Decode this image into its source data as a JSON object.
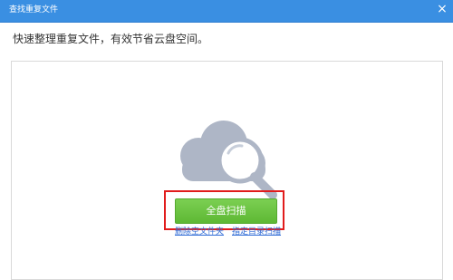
{
  "window": {
    "title": "查找重复文件",
    "close_glyph": "×"
  },
  "main": {
    "description": "快速整理重复文件，有效节省云盘空间。",
    "scan_button_label": "全盘扫描",
    "links": [
      "删除空文件夹",
      "指定目录扫描"
    ]
  },
  "colors": {
    "titlebar": "#3a8fe2",
    "scan_button": "#6cc444",
    "highlight_border": "#e11c1c",
    "link": "#2f6bd6"
  },
  "icons": {
    "illustration": "cloud-magnifier-icon"
  }
}
